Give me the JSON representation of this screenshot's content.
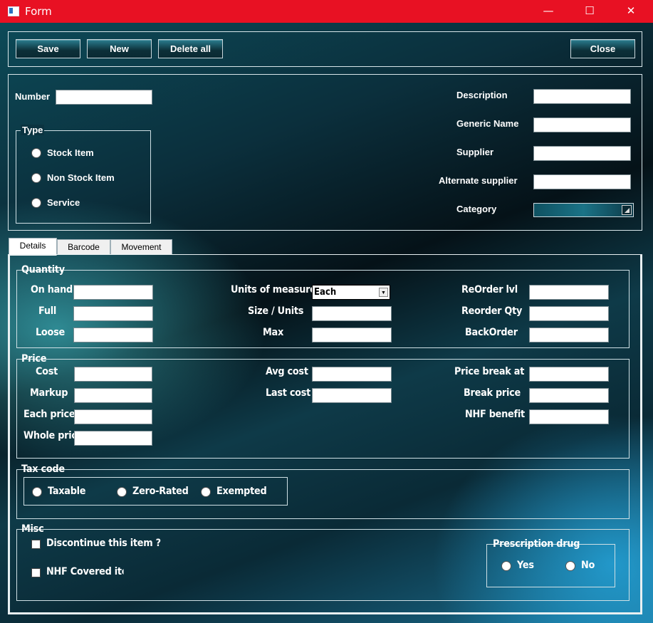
{
  "window": {
    "title": "Form",
    "minimize": "—",
    "maximize": "☐",
    "close": "✕"
  },
  "toolbar": {
    "save": "Save",
    "new": "New",
    "delete_all": "Delete all",
    "close": "Close"
  },
  "header": {
    "number_label": "Number",
    "type_legend": "Type",
    "type_options": [
      "Stock Item",
      "Non Stock Item",
      "Service"
    ],
    "description_label": "Description",
    "generic_name_label": "Generic Name",
    "supplier_label": "Supplier",
    "alternate_supplier_label": "Alternate supplier",
    "category_label": "Category"
  },
  "tabs": [
    "Details",
    "Barcode",
    "Movement"
  ],
  "quantity": {
    "legend": "Quantity",
    "on_hand": "On hand",
    "full": "Full",
    "loose": "Loose",
    "units_of_measure": "Units of measure",
    "units_value": "Each",
    "size_units": "Size / Units",
    "max": "Max",
    "reorder_lvl": "ReOrder lvl",
    "reorder_qty": "Reorder Qty",
    "backorder": "BackOrder"
  },
  "price": {
    "legend": "Price",
    "cost": "Cost",
    "markup": "Markup",
    "each_price": "Each price",
    "whole_price": "Whole price",
    "avg_cost": "Avg cost",
    "last_cost": "Last cost",
    "price_break_at": "Price break at",
    "break_price": "Break price",
    "nhf_benefit": "NHF benefit"
  },
  "tax": {
    "legend": "Tax code",
    "options": [
      "Taxable",
      "Zero-Rated",
      "Exempted"
    ]
  },
  "misc": {
    "legend": "Misc",
    "discontinue": "Discontinue this item ?",
    "nhf_covered": "NHF Covered item",
    "prescription_legend": "Prescription drug",
    "yes": "Yes",
    "no": "No"
  }
}
